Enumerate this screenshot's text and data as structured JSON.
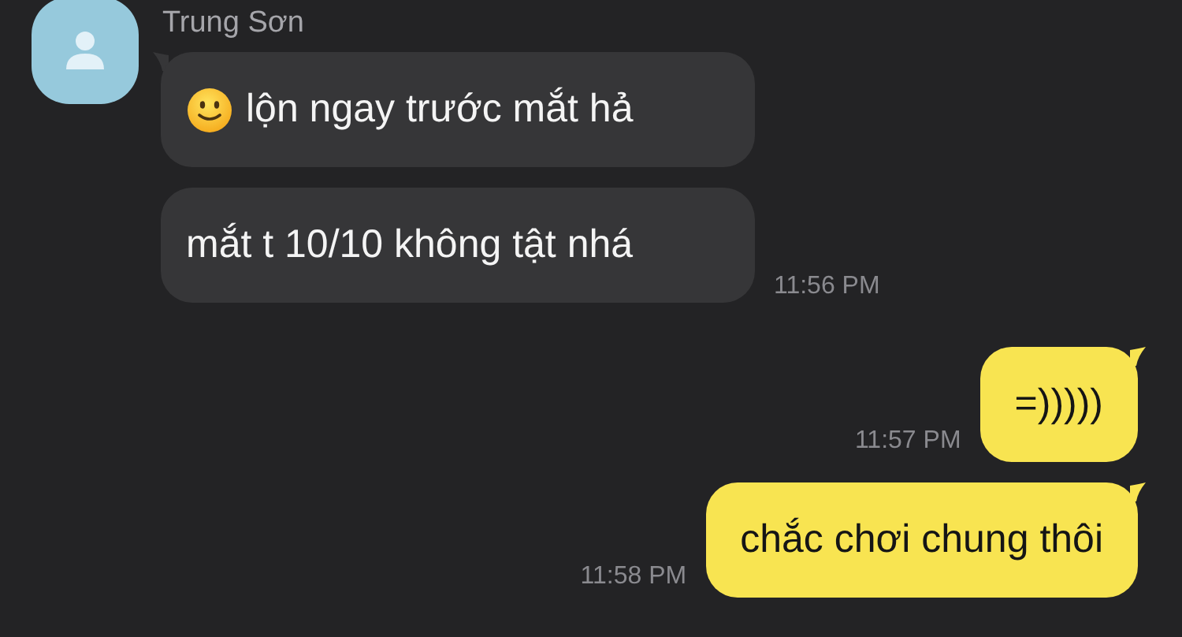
{
  "contact": {
    "name": "Trung Sơn"
  },
  "messages": [
    {
      "kind": "incoming",
      "leading_icon": true,
      "text": "lộn ngay trước mắt hả",
      "tail": true
    },
    {
      "kind": "incoming",
      "leading_icon": false,
      "text": "mắt t 10/10 không tật nhá",
      "tail": false,
      "time": "11:56 PM"
    },
    {
      "kind": "outgoing",
      "leading_icon": false,
      "text": "=)))))",
      "tail": true,
      "time": "11:57 PM"
    },
    {
      "kind": "outgoing",
      "leading_icon": false,
      "text": "chắc chơi chung thôi",
      "tail": true,
      "time": "11:58 PM"
    }
  ]
}
